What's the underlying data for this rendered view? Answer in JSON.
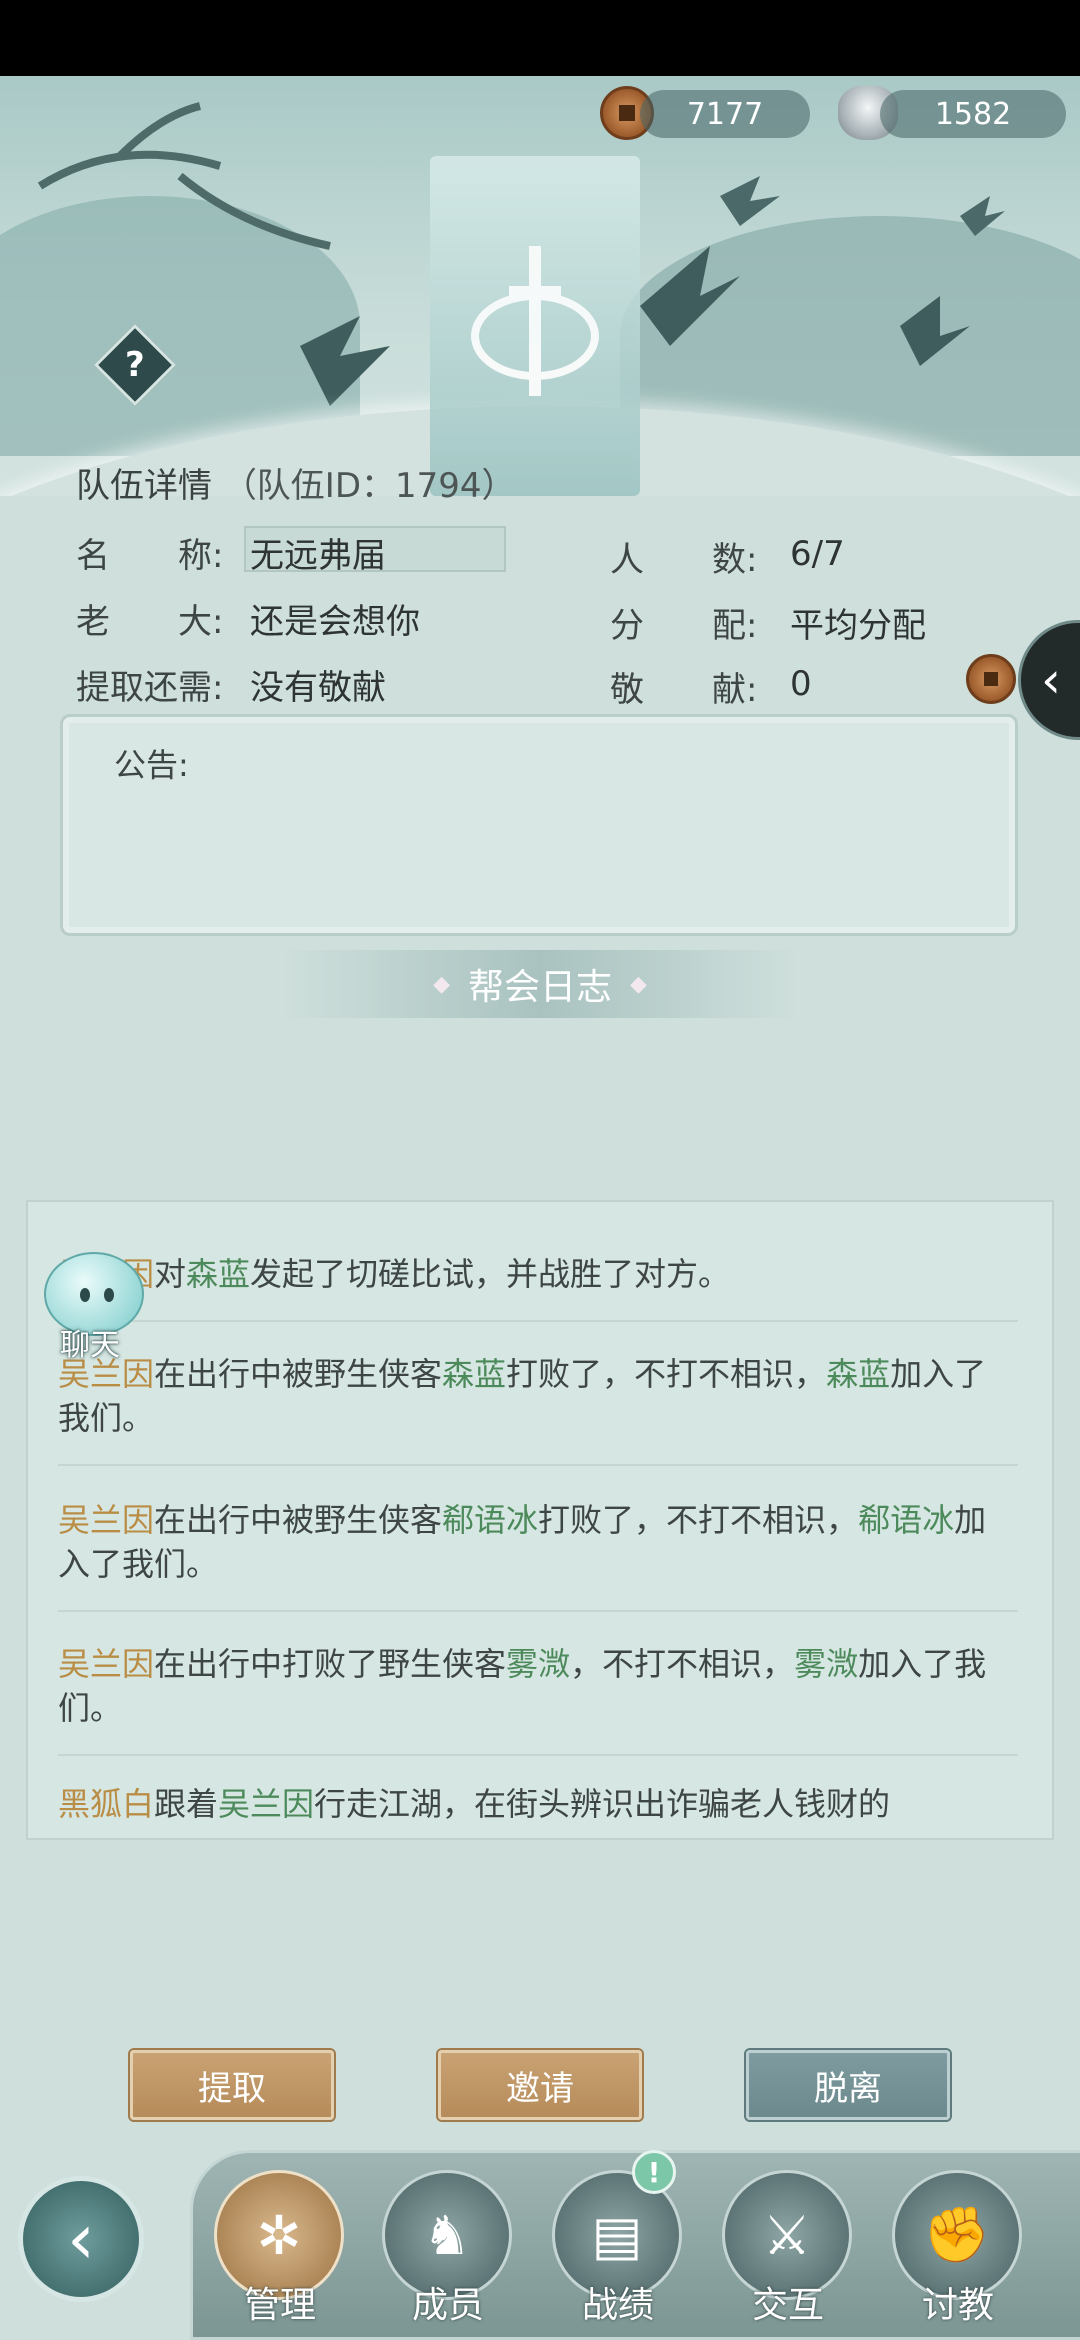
{
  "currency": {
    "copper": "7177",
    "silver": "1582"
  },
  "help_label": "?",
  "team": {
    "title": "队伍详情",
    "id_text": "（队伍ID：1794）",
    "name_label": "名　　称:",
    "name_value": "无远弗届",
    "count_label": "人　　数:",
    "count_value": "6/7",
    "leader_label": "老　　大:",
    "leader_value": "还是会想你",
    "distribution_label": "分　　配:",
    "distribution_value": "平均分配",
    "withdraw_label": "提取还需:",
    "withdraw_value": "没有敬献",
    "offering_label": "敬　　献:",
    "offering_value": "0"
  },
  "notice_label": "公告:",
  "log_title": "帮会日志",
  "chat_label": "聊天",
  "log_entries": [
    {
      "parts": [
        [
          "吴兰因",
          "o"
        ],
        [
          "对",
          ""
        ],
        [
          "森蓝",
          "g"
        ],
        [
          "发起了切磋比试，并战胜了对方。",
          ""
        ]
      ]
    },
    {
      "parts": [
        [
          "吴兰因",
          "o"
        ],
        [
          "在出行中被野生侠客",
          ""
        ],
        [
          "森蓝",
          "g"
        ],
        [
          "打败了，不打不相识，",
          ""
        ],
        [
          "森蓝",
          "g"
        ],
        [
          "加入了我们。",
          ""
        ]
      ]
    },
    {
      "parts": [
        [
          "吴兰因",
          "o"
        ],
        [
          "在出行中被野生侠客",
          ""
        ],
        [
          "郗语冰",
          "g"
        ],
        [
          "打败了，不打不相识，",
          ""
        ],
        [
          "郗语冰",
          "g"
        ],
        [
          "加入了我们。",
          ""
        ]
      ]
    },
    {
      "parts": [
        [
          "吴兰因",
          "o"
        ],
        [
          "在出行中打败了野生侠客",
          ""
        ],
        [
          "雾溦",
          "g"
        ],
        [
          "，不打不相识，",
          ""
        ],
        [
          "雾溦",
          "g"
        ],
        [
          "加入了我们。",
          ""
        ]
      ]
    },
    {
      "parts": [
        [
          "黑狐白",
          "o"
        ],
        [
          "跟着",
          ""
        ],
        [
          "吴兰因",
          "g"
        ],
        [
          "行走江湖，在街头辨识出诈骗老人钱财的",
          ""
        ]
      ]
    }
  ],
  "buttons": {
    "withdraw": "提取",
    "invite": "邀请",
    "leave": "脱离"
  },
  "nav": [
    {
      "label": "管理",
      "icon": "manage-icon",
      "glyph": "✲",
      "active": true
    },
    {
      "label": "成员",
      "icon": "members-icon",
      "glyph": "♞",
      "active": false
    },
    {
      "label": "战绩",
      "icon": "record-icon",
      "glyph": "▤",
      "active": false
    },
    {
      "label": "交互",
      "icon": "interact-icon",
      "glyph": "⚔",
      "active": false
    },
    {
      "label": "讨教",
      "icon": "spar-icon",
      "glyph": "✊",
      "active": false
    }
  ],
  "alert_badge": "!",
  "colors": {
    "name_orange": "#b98d45",
    "name_green": "#4d8a5b",
    "gold_button": "#c9a273",
    "grey_button": "#7e9c9f"
  }
}
